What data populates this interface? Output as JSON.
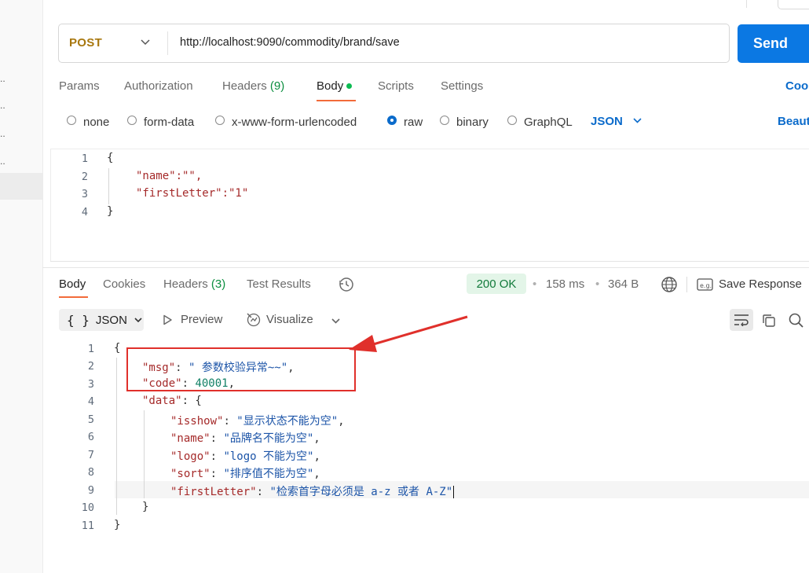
{
  "request": {
    "method": "POST",
    "url": "http://localhost:9090/commodity/brand/save",
    "send_label": "Send",
    "tabs": [
      {
        "label": "Params"
      },
      {
        "label": "Authorization"
      },
      {
        "label": "Headers",
        "count": "(9)"
      },
      {
        "label": "Body"
      },
      {
        "label": "Scripts"
      },
      {
        "label": "Settings"
      }
    ],
    "cookies_label": "Coo",
    "body_types": [
      "none",
      "form-data",
      "x-www-form-urlencoded",
      "raw",
      "binary",
      "GraphQL"
    ],
    "selected_body_type": "raw",
    "format": "JSON",
    "beautify_label": "Beaut",
    "editor": {
      "line_numbers": [
        "1",
        "2",
        "3",
        "4"
      ],
      "lines": [
        "{",
        "\"name\":\"\",",
        "\"firstLetter\":\"1\"",
        "}"
      ]
    }
  },
  "response": {
    "tabs": [
      {
        "label": "Body"
      },
      {
        "label": "Cookies"
      },
      {
        "label": "Headers",
        "count": "(3)"
      },
      {
        "label": "Test Results"
      }
    ],
    "status": "200 OK",
    "time": "158 ms",
    "size": "364 B",
    "save_label": "Save Response",
    "format": "JSON",
    "preview_label": "Preview",
    "visualize_label": "Visualize",
    "line_numbers": [
      "1",
      "2",
      "3",
      "4",
      "5",
      "6",
      "7",
      "8",
      "9",
      "10",
      "11"
    ],
    "body": {
      "msg": "\" 参数校验异常~~\"",
      "code": "40001",
      "data": {
        "isshow": "\"显示状态不能为空\"",
        "name": "\"品牌名不能为空\"",
        "logo": "\"logo 不能为空\"",
        "sort": "\"排序值不能为空\"",
        "firstLetter": "\"检索首字母必须是 a-z 或者 A-Z\""
      }
    }
  },
  "colors": {
    "accent": "#0b78e3",
    "method": "#a8770e",
    "tab_underline": "#f26b3a",
    "status_ok_bg": "#e3f5e8",
    "annotation": "#e0302b"
  },
  "icons": [
    "chevron-down-icon",
    "radio-icon",
    "history-icon",
    "globe-icon",
    "save-response-icon",
    "braces-icon",
    "play-icon",
    "visualize-icon",
    "wrap-icon",
    "copy-icon",
    "search-icon",
    "annotation-arrow-icon"
  ]
}
